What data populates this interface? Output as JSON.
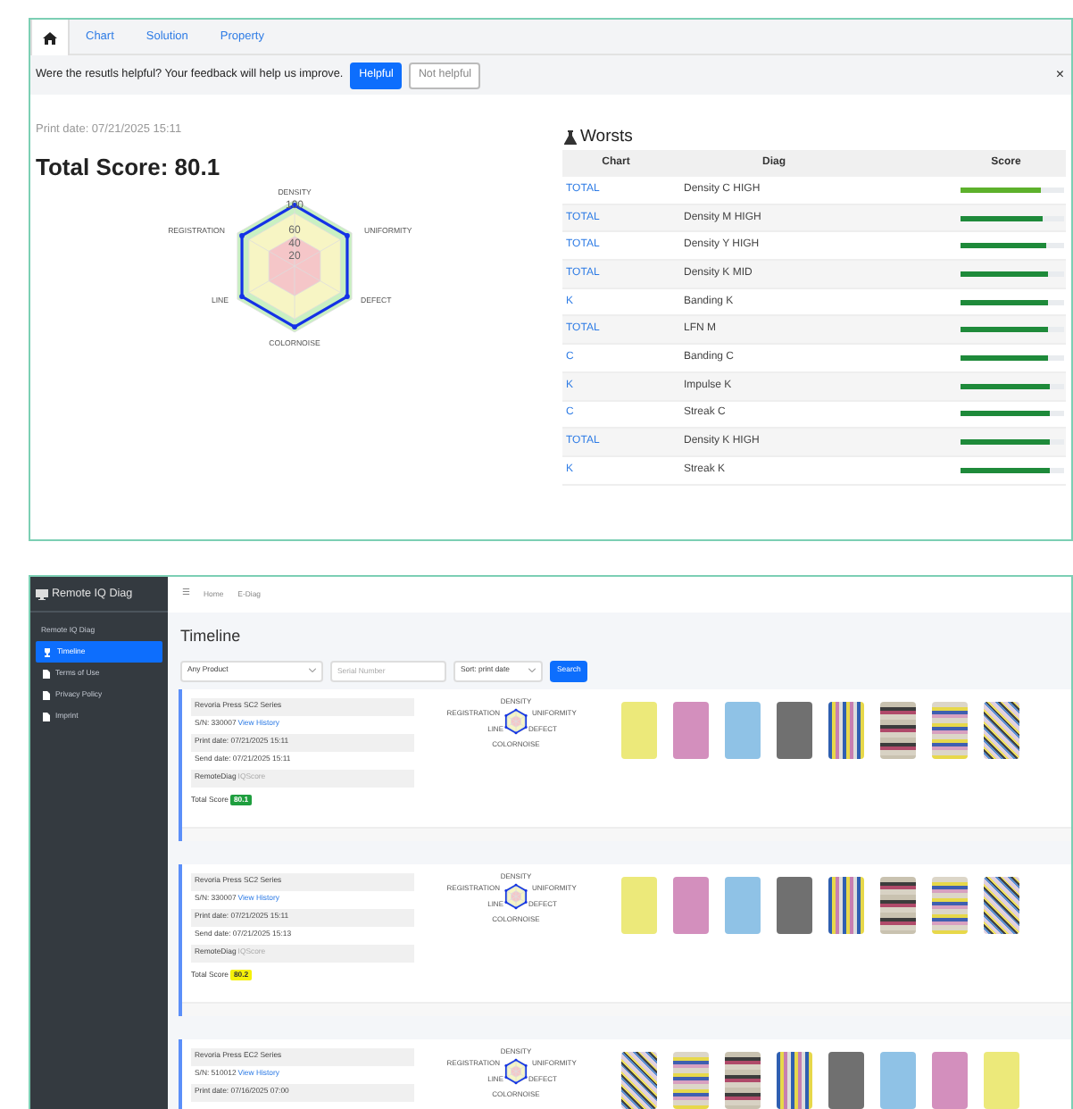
{
  "result_panel": {
    "tabs": [
      {
        "kind": "home",
        "selected": true
      },
      {
        "kind": "text",
        "label": "Chart",
        "selected": false
      },
      {
        "kind": "text",
        "label": "Solution",
        "selected": false
      },
      {
        "kind": "text",
        "label": "Property",
        "selected": false
      }
    ],
    "feedback": {
      "question": "Were the resutls helpful? Your feedback will help us improve.",
      "buttons": [
        {
          "label": "Helpful",
          "kind": "primary"
        },
        {
          "label": "Not helpful",
          "kind": "outline"
        }
      ],
      "close": "×"
    },
    "print_date": "Print date: 07/21/2025 15:11",
    "total_score": "Total Score: 80.1",
    "radar": {
      "axes": [
        "DENSITY",
        "REGISTRATION",
        "UNIFORMITY",
        "LINE",
        "DEFECT",
        "COLORNOISE"
      ],
      "ticks": [
        "100",
        "60",
        "40",
        "20"
      ]
    },
    "worsts": {
      "title": "Worsts",
      "columns": [
        "Chart",
        "Diag",
        "Score"
      ],
      "rows": [
        {
          "chart": "TOTAL",
          "diag": "Density C HIGH",
          "level": 0.77,
          "color": "#5db12c"
        },
        {
          "chart": "TOTAL",
          "diag": "Density M HIGH",
          "level": 0.8,
          "color": "#1e8a3a"
        },
        {
          "chart": "TOTAL",
          "diag": "Density Y HIGH",
          "level": 0.83,
          "color": "#1e8a3a"
        },
        {
          "chart": "TOTAL",
          "diag": "Density K MID",
          "level": 0.84,
          "color": "#1e8a3a"
        },
        {
          "chart": "K",
          "diag": "Banding K",
          "level": 0.84,
          "color": "#1e8a3a"
        },
        {
          "chart": "TOTAL",
          "diag": "LFN M",
          "level": 0.85,
          "color": "#1e8a3a"
        },
        {
          "chart": "C",
          "diag": "Banding C",
          "level": 0.85,
          "color": "#1e8a3a"
        },
        {
          "chart": "K",
          "diag": "Impulse K",
          "level": 0.86,
          "color": "#1e8a3a"
        },
        {
          "chart": "C",
          "diag": "Streak C",
          "level": 0.86,
          "color": "#1e8a3a"
        },
        {
          "chart": "TOTAL",
          "diag": "Density K HIGH",
          "level": 0.86,
          "color": "#1e8a3a"
        },
        {
          "chart": "K",
          "diag": "Streak K",
          "level": 0.87,
          "color": "#1e8a3a"
        }
      ]
    }
  },
  "app": {
    "sidebar": {
      "brand": "Remote IQ Diag",
      "section": "Remote IQ Diag",
      "items": [
        {
          "label": "Timeline",
          "selected": true
        },
        {
          "label": "Terms of Use",
          "selected": false
        },
        {
          "label": "Privacy Policy",
          "selected": false
        },
        {
          "label": "Imprint",
          "selected": false
        }
      ]
    },
    "menu": "☰",
    "breadcrumb": [
      "Home",
      "E-Diag"
    ],
    "title": "Timeline",
    "filters": {
      "product": "Any Product",
      "serial_placeholder": "Serial Number",
      "sort": "Sort: print date",
      "search": "Search"
    },
    "cards": [
      {
        "product": "Revoria Press SC2 Series",
        "serial": "S/N: 330007",
        "history_link": "View History",
        "print_date": "Print date: 07/21/2025 15:11",
        "send_date": "Send date: 07/21/2025 15:11",
        "diag": "RemoteDiag",
        "diag_sub": "IQScore",
        "score_label": "Total Score",
        "score": "80.1",
        "kind": "good",
        "radar_labels": [
          "DENSITY",
          "REGISTRATION",
          "UNIFORMITY",
          "LINE",
          "DEFECT",
          "COLORNOISE"
        ],
        "thumbnails": [
          {
            "kind": "yellow"
          },
          {
            "kind": "magenta"
          },
          {
            "kind": "cyan"
          },
          {
            "kind": "black"
          },
          {
            "kind": "vstripes"
          },
          {
            "kind": "hstripes"
          },
          {
            "kind": "bands"
          },
          {
            "kind": "pattern"
          }
        ]
      },
      {
        "product": "Revoria Press SC2 Series",
        "serial": "S/N: 330007",
        "history_link": "View History",
        "print_date": "Print date: 07/21/2025 15:11",
        "send_date": "Send date: 07/21/2025 15:13",
        "diag": "RemoteDiag",
        "diag_sub": "IQScore",
        "score_label": "Total Score",
        "score": "80.2",
        "kind": "fair",
        "radar_labels": [
          "DENSITY",
          "REGISTRATION",
          "UNIFORMITY",
          "LINE",
          "DEFECT",
          "COLORNOISE"
        ],
        "thumbnails": [
          {
            "kind": "yellow"
          },
          {
            "kind": "magenta"
          },
          {
            "kind": "cyan"
          },
          {
            "kind": "black"
          },
          {
            "kind": "vstripes"
          },
          {
            "kind": "hstripes"
          },
          {
            "kind": "bands"
          },
          {
            "kind": "pattern"
          }
        ]
      },
      {
        "product": "Revoria Press EC2 Series",
        "serial": "S/N: 510012",
        "history_link": "View History",
        "print_date": "Print date: 07/16/2025 07:00",
        "radar_labels": [
          "DENSITY",
          "REGISTRATION",
          "UNIFORMITY",
          "LINE",
          "DEFECT",
          "COLORNOISE"
        ],
        "thumbnails": [
          {
            "kind": "pattern"
          },
          {
            "kind": "bands"
          },
          {
            "kind": "hstripes"
          },
          {
            "kind": "vstripes"
          },
          {
            "kind": "black"
          },
          {
            "kind": "cyan"
          },
          {
            "kind": "magenta"
          },
          {
            "kind": "yellow"
          }
        ]
      }
    ]
  }
}
